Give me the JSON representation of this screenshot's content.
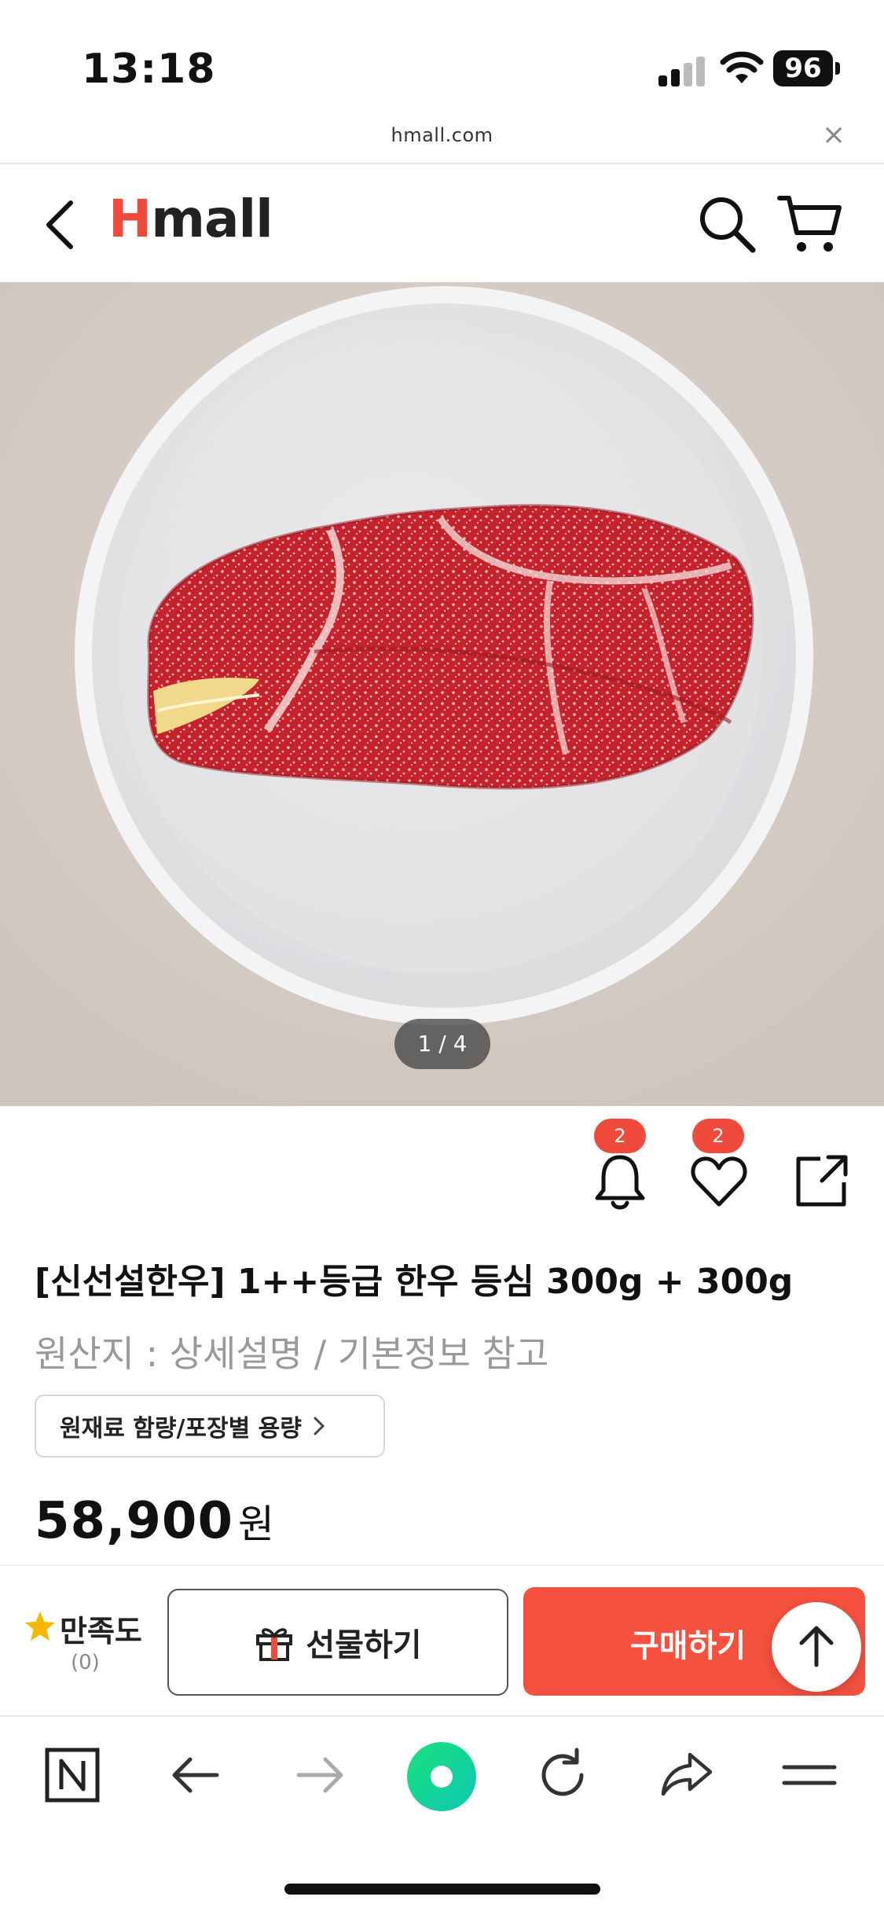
{
  "status_bar": {
    "time": "13:18",
    "battery": "96"
  },
  "browser": {
    "url": "hmall.com",
    "close_glyph": "×"
  },
  "header": {
    "logo_first": "H",
    "logo_rest": "mall"
  },
  "gallery": {
    "counter": "1 / 4",
    "current_index": 1,
    "total": 4
  },
  "actions": {
    "alarm_count": "2",
    "wishlist_count": "2"
  },
  "product": {
    "title": "[신선설한우] 1++등급 한우 등심 300g + 300g",
    "origin": "원산지 : 상세설명 / 기본정보 참고",
    "ingredient_button": "원재료 함량/포장별 용량",
    "price": "58,900",
    "price_unit": "원"
  },
  "purchase_bar": {
    "rating_label": "만족도",
    "rating_count": "(0)",
    "gift_label": "선물하기",
    "buy_label": "구매하기"
  },
  "colors": {
    "brand_red": "#f04a3c",
    "buy_button": "#f5513f",
    "badge": "#f04a3c",
    "star": "#f5b800",
    "toolbar_green": "#1ed97a"
  },
  "icons": [
    "back-icon",
    "search-icon",
    "cart-icon",
    "bell-icon",
    "heart-icon",
    "share-icon",
    "gift-icon",
    "star-icon",
    "arrow-up-icon",
    "naver-icon",
    "nav-back-icon",
    "nav-forward-icon",
    "green-dot-icon",
    "refresh-icon",
    "share-arrow-icon",
    "menu-icon"
  ]
}
